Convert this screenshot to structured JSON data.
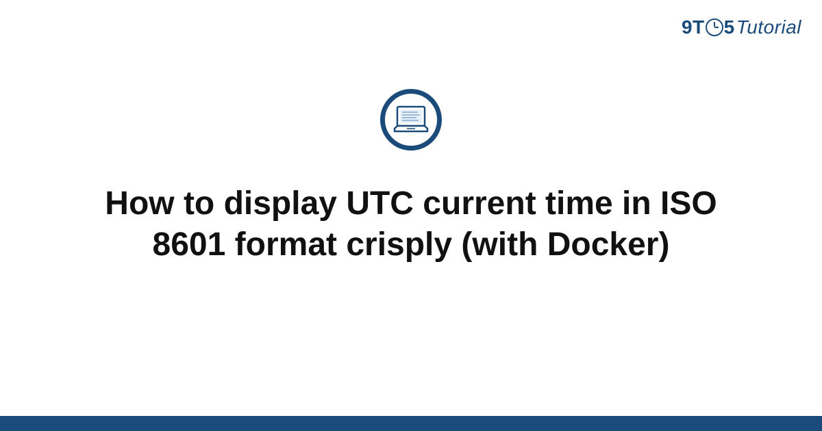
{
  "logo": {
    "part1": "9T",
    "part2": "5",
    "part3": "Tutorial"
  },
  "title": "How to display UTC current time in ISO 8601 format crisply (with Docker)",
  "colors": {
    "brand": "#1a4b7a",
    "accent_light": "#a8c4e0"
  }
}
